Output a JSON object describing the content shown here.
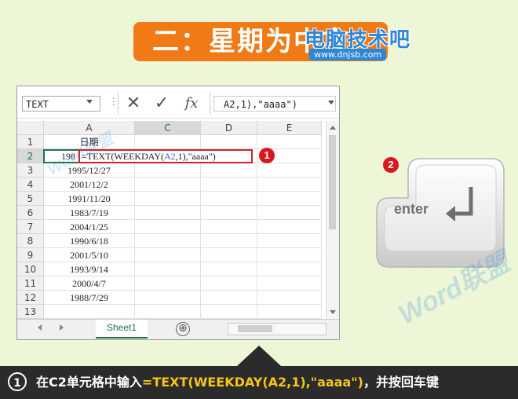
{
  "title": "二：星期为中文",
  "logo": {
    "brand": "电脑技术吧",
    "url": "www.dnjsb.com"
  },
  "excel": {
    "namebox": "TEXT",
    "formula_buttons": {
      "cancel": "✕",
      "enter": "✓",
      "insert_fn": "fx"
    },
    "formula_bar": "A2,1),\"aaaa\")",
    "columns": [
      "A",
      "C",
      "D",
      "E"
    ],
    "rows": [
      {
        "num": "1",
        "a": "日期"
      },
      {
        "num": "2",
        "a": "198"
      },
      {
        "num": "3",
        "a": "1995/12/27"
      },
      {
        "num": "4",
        "a": "2001/12/2"
      },
      {
        "num": "5",
        "a": "1991/11/20"
      },
      {
        "num": "6",
        "a": "1983/7/19"
      },
      {
        "num": "7",
        "a": "2004/1/25"
      },
      {
        "num": "8",
        "a": "1990/6/18"
      },
      {
        "num": "9",
        "a": "2001/5/10"
      },
      {
        "num": "10",
        "a": "1993/9/14"
      },
      {
        "num": "11",
        "a": "2000/4/7"
      },
      {
        "num": "12",
        "a": "1988/7/29"
      },
      {
        "num": "13",
        "a": ""
      }
    ],
    "edit_formula": {
      "prefix": "=TEXT(WEEKDAY(",
      "ref": "A2",
      "suffix": ",1),\"aaaa\")"
    },
    "sheet_tab": "Sheet1",
    "add_sheet": "⊕"
  },
  "badges": {
    "one": "1",
    "two": "2"
  },
  "enter_key": {
    "label": "enter"
  },
  "watermark": "Word联盟",
  "caption": {
    "step": "1",
    "prefix": "在C2单元格中输入",
    "formula": "=TEXT(WEEKDAY(A2,1),\"aaaa\")",
    "suffix": "，并按回车键"
  },
  "colors": {
    "accent": "#ef7a16",
    "excel_green": "#217346",
    "badge_red": "#d7181f",
    "caption_bg": "#2b2b2b",
    "formula_yellow": "#f5c518"
  }
}
